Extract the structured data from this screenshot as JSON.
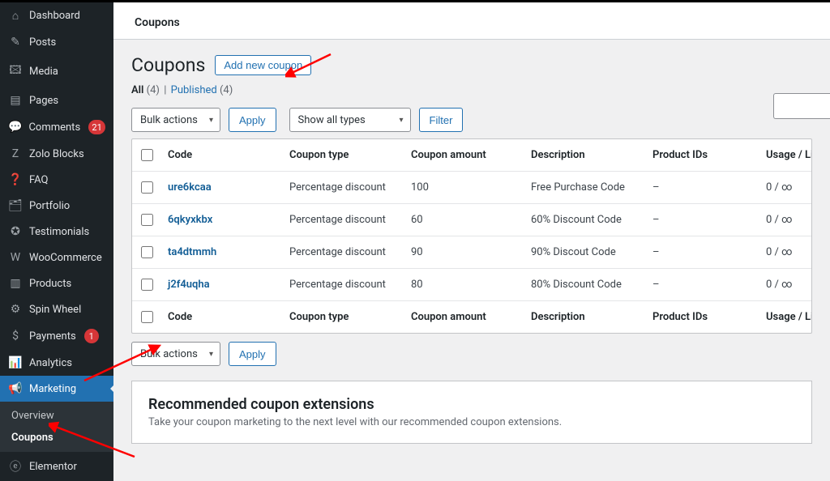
{
  "sidebar": {
    "items": [
      {
        "icon": "⌂",
        "label": "Dashboard"
      },
      {
        "icon": "✎",
        "label": "Posts"
      },
      {
        "icon": "🖾",
        "label": "Media"
      },
      {
        "icon": "▤",
        "label": "Pages"
      },
      {
        "icon": "💬",
        "label": "Comments",
        "badge": "21"
      },
      {
        "icon": "Z",
        "label": "Zolo Blocks"
      },
      {
        "icon": "❓",
        "label": "FAQ"
      },
      {
        "icon": "🗂",
        "label": "Portfolio"
      },
      {
        "icon": "✪",
        "label": "Testimonials"
      },
      {
        "icon": "W",
        "label": "WooCommerce"
      },
      {
        "icon": "▥",
        "label": "Products"
      },
      {
        "icon": "⚙",
        "label": "Spin Wheel"
      },
      {
        "icon": "$",
        "label": "Payments",
        "badge": "1"
      },
      {
        "icon": "📊",
        "label": "Analytics"
      },
      {
        "icon": "📢",
        "label": "Marketing",
        "active": true
      },
      {
        "icon": "ⓔ",
        "label": "Elementor"
      }
    ],
    "submenu": [
      {
        "label": "Overview"
      },
      {
        "label": "Coupons",
        "current": true
      }
    ]
  },
  "tabbar": {
    "active": "Coupons"
  },
  "title": "Coupons",
  "add_button": "Add new coupon",
  "filters": {
    "all_label": "All",
    "all_count": "(4)",
    "sep": "|",
    "published_label": "Published",
    "published_count": "(4)"
  },
  "toolbar": {
    "bulk": "Bulk actions",
    "apply": "Apply",
    "types": "Show all types",
    "filter": "Filter"
  },
  "table": {
    "headers": [
      "Code",
      "Coupon type",
      "Coupon amount",
      "Description",
      "Product IDs",
      "Usage / Limit"
    ],
    "rows": [
      {
        "code": "ure6kcaa",
        "type": "Percentage discount",
        "amount": "100",
        "desc": "Free Purchase Code",
        "products": "–",
        "usage": "0 / ∞"
      },
      {
        "code": "6qkyxkbx",
        "type": "Percentage discount",
        "amount": "60",
        "desc": "60% Discount Code",
        "products": "–",
        "usage": "0 / ∞"
      },
      {
        "code": "ta4dtmmh",
        "type": "Percentage discount",
        "amount": "90",
        "desc": "90% Discout Code",
        "products": "–",
        "usage": "0 / ∞"
      },
      {
        "code": "j2f4uqha",
        "type": "Percentage discount",
        "amount": "80",
        "desc": "80% Discount Code",
        "products": "–",
        "usage": "0 / ∞"
      }
    ]
  },
  "recommended": {
    "title": "Recommended coupon extensions",
    "text": "Take your coupon marketing to the next level with our recommended coupon extensions."
  }
}
